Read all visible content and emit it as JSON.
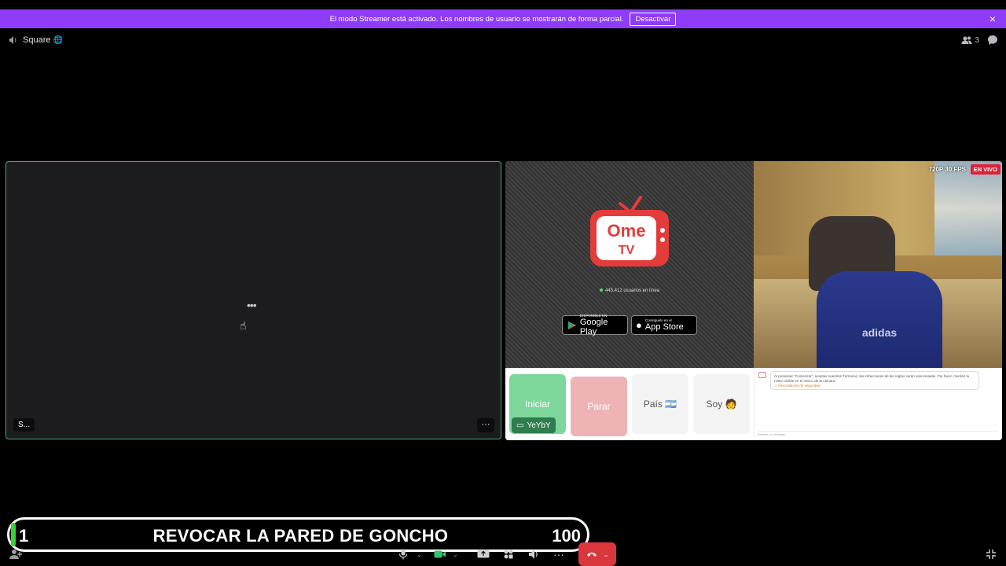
{
  "banner": {
    "message": "El modo Streamer está activado. Los nombres de usuario se mostrarán de forma parcial.",
    "deactivate": "Desactivar",
    "close": "×"
  },
  "topbar": {
    "channel_name": "Square",
    "channel_emoji": "🌐",
    "member_count": "3"
  },
  "tiles": {
    "left": {
      "loading": "•••",
      "name_tag": "S...",
      "more": "···"
    },
    "right": {
      "ome": {
        "logo_top": "Ome",
        "logo_bottom": "TV",
        "online_text": "445.412 usuarios en línea",
        "google_small": "DISPONIBLE EN",
        "google_big": "Google Play",
        "apple_small": "Consíguelo en el",
        "apple_big": "App Store"
      },
      "cam": {
        "quality": "720P 30 FPS",
        "live": "EN VIVO",
        "shirt_text": "adidas"
      },
      "controls": {
        "start": "Iniciar",
        "stop": "Parar",
        "country": "País 🇦🇷",
        "iam": "Soy 🧑",
        "user_tag": "YeYbY"
      },
      "chat": {
        "message": "Al presionar \"Comenzar\", aceptas nuestros Términos, las infracciones de las reglas serán sancionadas. Por favor, mantén tu rostro visible en el marco de la cámara.",
        "warning": "⚠ Recordatorio de seguridad",
        "input_placeholder": "Escribe un mensaje"
      }
    }
  },
  "goal": {
    "current": "1",
    "label": "REVOCAR LA PARED DE GONCHO",
    "target": "100",
    "progress": 0.01,
    "fill_color": "#37d23a"
  },
  "bottom": {
    "icons": [
      "mic-icon",
      "chevron-down-icon",
      "camera-icon",
      "chevron-down-icon",
      "screen-share-icon",
      "activities-icon",
      "soundboard-icon",
      "more-icon",
      "hangup-icon",
      "chevron-down-icon",
      "fullscreen-exit-icon"
    ]
  },
  "colors": {
    "banner": "#8e3cf7",
    "speaking_border": "#2fb36b",
    "hangup": "#da373c",
    "live": "#e0213c"
  }
}
